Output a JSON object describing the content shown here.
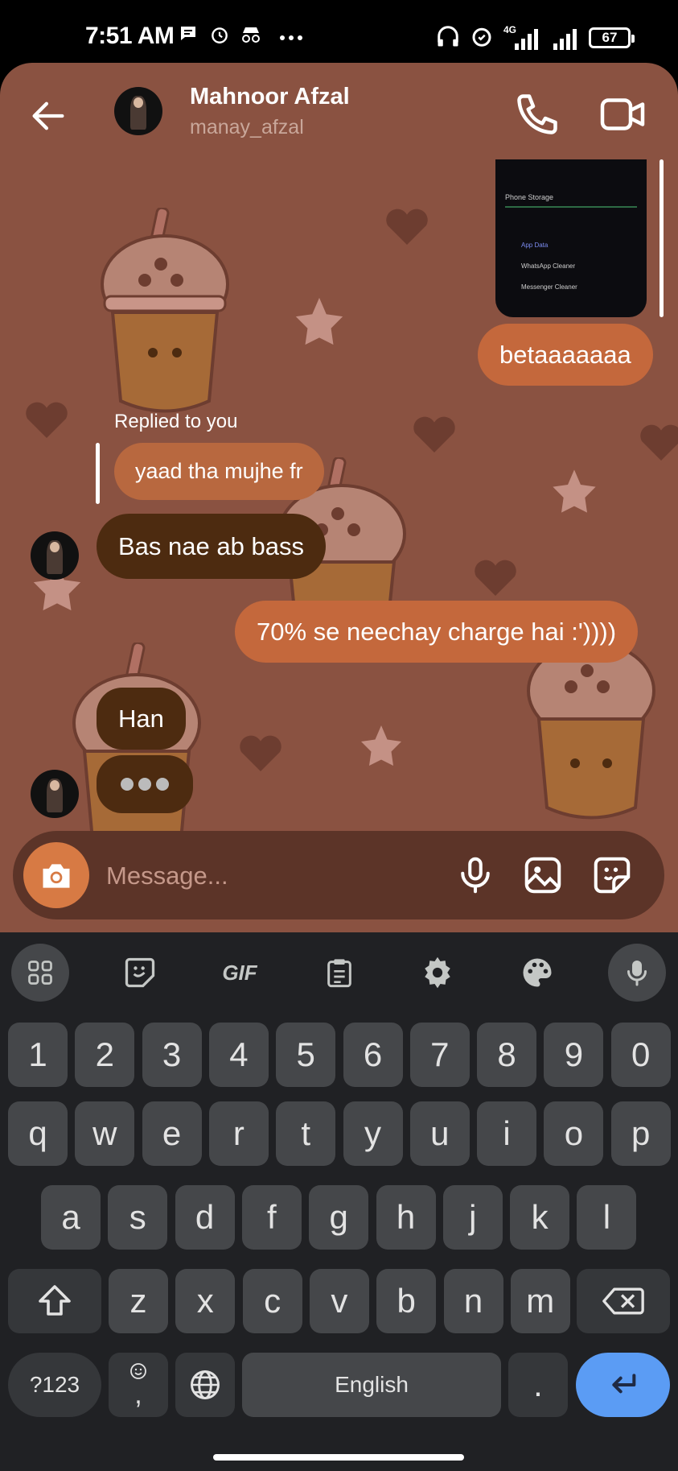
{
  "status_bar": {
    "time": "7:51 AM",
    "network": "4G",
    "battery": "67"
  },
  "header": {
    "name": "Mahnoor Afzal",
    "username": "manay_afzal",
    "icons": [
      "back-arrow-icon",
      "phone-icon",
      "video-camera-icon"
    ]
  },
  "screenshot_preview": {
    "lines": [
      "Phone Storage",
      "App Data",
      "WhatsApp Cleaner",
      "Messenger Cleaner"
    ]
  },
  "messages": {
    "m1": "betaaaaaaa",
    "reply_label": "Replied to you",
    "m2": "yaad tha mujhe fr",
    "m3": "Bas nae ab bass",
    "m4": "70% se neechay charge hai :')))) ",
    "m5": "Han"
  },
  "composer": {
    "placeholder": "Message..."
  },
  "keyboard": {
    "toolbar": [
      "apps-grid-icon",
      "sticker-icon",
      "GIF",
      "clipboard-icon",
      "settings-gear-icon",
      "palette-icon",
      "mic-icon"
    ],
    "gif_label": "GIF",
    "row_numbers": [
      "1",
      "2",
      "3",
      "4",
      "5",
      "6",
      "7",
      "8",
      "9",
      "0"
    ],
    "row1": [
      "q",
      "w",
      "e",
      "r",
      "t",
      "y",
      "u",
      "i",
      "o",
      "p"
    ],
    "row2": [
      "a",
      "s",
      "d",
      "f",
      "g",
      "h",
      "j",
      "k",
      "l"
    ],
    "row3": [
      "z",
      "x",
      "c",
      "v",
      "b",
      "n",
      "m"
    ],
    "symbols_key": "?123",
    "emoji_comma": ",",
    "space_label": "English",
    "period": ".",
    "colors": {
      "enter": "#5b9cf4",
      "key": "#45474a",
      "bg": "#202124"
    }
  },
  "colors": {
    "chat_bg": "#8a5241",
    "outgoing": "#c4683c",
    "incoming": "#4d2b10"
  }
}
